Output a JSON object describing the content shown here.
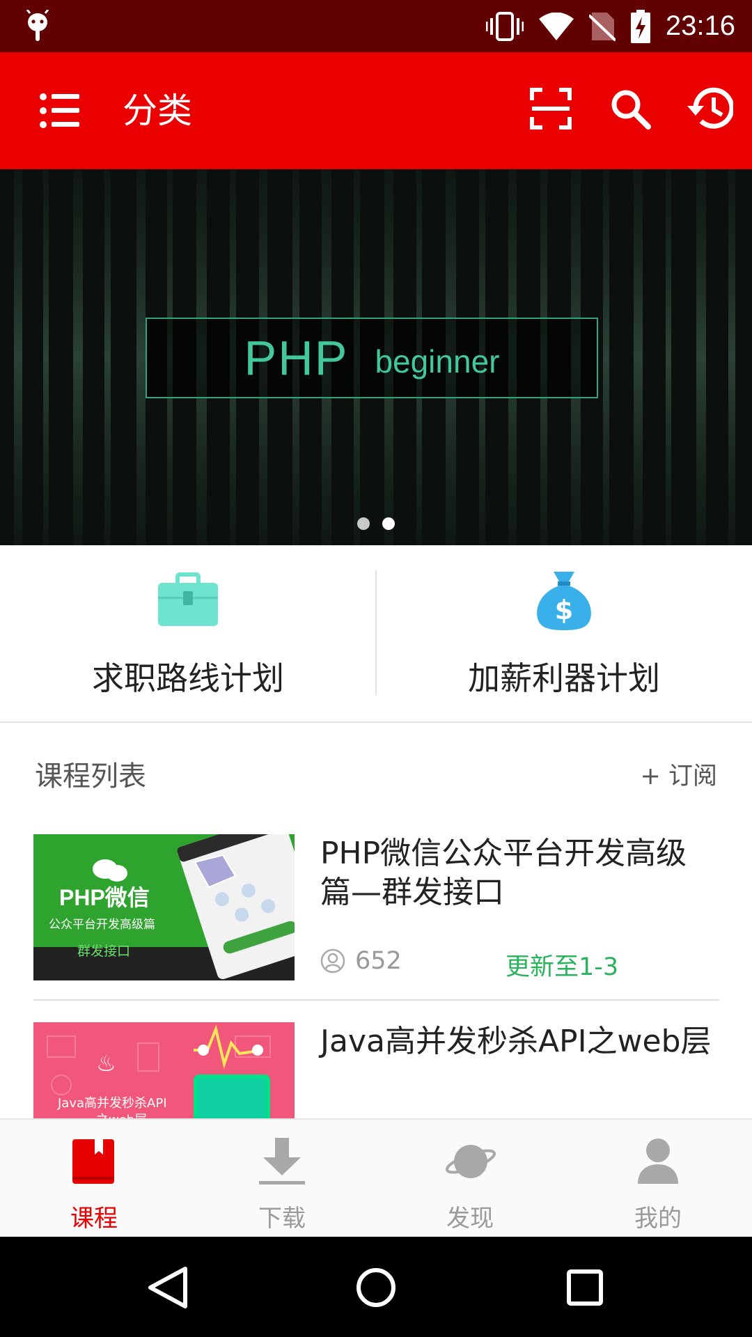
{
  "status_bar": {
    "time": "23:16",
    "icons": [
      "android-debug-icon",
      "vibrate-icon",
      "wifi-icon",
      "no-sim-icon",
      "battery-charging-icon"
    ]
  },
  "app_bar": {
    "title": "分类",
    "icons": [
      "menu-icon",
      "scan-icon",
      "search-icon",
      "history-icon"
    ],
    "background": "#ea0000"
  },
  "banner": {
    "headline": "PHP",
    "subline": "beginner",
    "active_slide": 2,
    "slide_count": 2
  },
  "plans": [
    {
      "label": "求职路线计划",
      "icon": "briefcase-icon",
      "color": "#6ee4cf"
    },
    {
      "label": "加薪利器计划",
      "icon": "money-bag-icon",
      "color": "#3ab0ea"
    }
  ],
  "course_list": {
    "title": "课程列表",
    "subscribe_label": "+ 订阅",
    "courses": [
      {
        "title": "PHP微信公众平台开发高级篇—群发接口",
        "students": "652",
        "update": "更新至1-3",
        "thumb_title": "PHP微信",
        "thumb_sub": "公众平台开发高级篇",
        "thumb_tag": "群发接口"
      },
      {
        "title": "Java高并发秒杀API之web层",
        "thumb_title": "Java高并发秒杀API",
        "thumb_sub": "之web层"
      }
    ]
  },
  "bottom_nav": [
    {
      "label": "课程",
      "icon": "book-icon",
      "active": true
    },
    {
      "label": "下载",
      "icon": "download-icon",
      "active": false
    },
    {
      "label": "发现",
      "icon": "planet-icon",
      "active": false
    },
    {
      "label": "我的",
      "icon": "person-icon",
      "active": false
    }
  ],
  "colors": {
    "accent": "#ea0000",
    "status_bar": "#610000",
    "update_green": "#2ab25c"
  }
}
